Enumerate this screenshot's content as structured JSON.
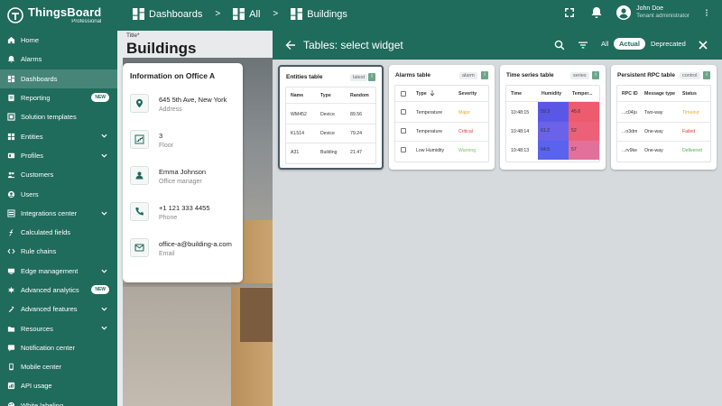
{
  "brand": {
    "name": "ThingsBoard",
    "edition": "Professional"
  },
  "breadcrumb": [
    {
      "label": "Dashboards",
      "icon": "dashboard-icon"
    },
    {
      "label": "All",
      "icon": "dashboard-icon"
    },
    {
      "label": "Buildings",
      "icon": "dashboard-icon"
    }
  ],
  "breadcrumb_sep": ">",
  "user": {
    "name": "John Doe",
    "role": "Tenant administrator"
  },
  "sidebar": {
    "items": [
      {
        "label": "Home",
        "icon": "home-icon"
      },
      {
        "label": "Alarms",
        "icon": "alarm-icon"
      },
      {
        "label": "Dashboards",
        "icon": "dashboard-icon",
        "active": true
      },
      {
        "label": "Reporting",
        "icon": "report-icon",
        "badge": "NEW"
      },
      {
        "label": "Solution templates",
        "icon": "template-icon"
      },
      {
        "label": "Entities",
        "icon": "entities-icon",
        "expandable": true
      },
      {
        "label": "Profiles",
        "icon": "profiles-icon",
        "expandable": true
      },
      {
        "label": "Customers",
        "icon": "customers-icon"
      },
      {
        "label": "Users",
        "icon": "users-icon"
      },
      {
        "label": "Integrations center",
        "icon": "integrations-icon",
        "expandable": true
      },
      {
        "label": "Calculated fields",
        "icon": "function-icon"
      },
      {
        "label": "Rule chains",
        "icon": "rule-chain-icon"
      },
      {
        "label": "Edge management",
        "icon": "edge-icon",
        "expandable": true
      },
      {
        "label": "Advanced analytics",
        "icon": "analytics-icon",
        "badge": "NEW"
      },
      {
        "label": "Advanced features",
        "icon": "features-icon",
        "expandable": true
      },
      {
        "label": "Resources",
        "icon": "resources-icon",
        "expandable": true
      },
      {
        "label": "Notification center",
        "icon": "notification-icon"
      },
      {
        "label": "Mobile center",
        "icon": "mobile-icon"
      },
      {
        "label": "API usage",
        "icon": "api-icon"
      },
      {
        "label": "White labeling",
        "icon": "palette-icon"
      }
    ]
  },
  "dashboard": {
    "title_label": "Title*",
    "title": "Buildings",
    "card": {
      "title": "Information on Office A",
      "rows": [
        {
          "value": "645 5th Ave, New York",
          "label": "Address",
          "icon": "location-icon"
        },
        {
          "value": "3",
          "label": "Floor",
          "icon": "floor-icon"
        },
        {
          "value": "Emma Johnson",
          "label": "Office manager",
          "icon": "person-icon"
        },
        {
          "value": "+1 121 333 4455",
          "label": "Phone",
          "icon": "phone-icon"
        },
        {
          "value": "office-a@building-a.com",
          "label": "Email",
          "icon": "email-icon"
        }
      ]
    }
  },
  "panel": {
    "title": "Tables: select widget",
    "filters": [
      "All",
      "Actual",
      "Deprecated"
    ],
    "selected_filter": "Actual"
  },
  "widgets": [
    {
      "title": "Entities table",
      "tag": "latest",
      "headers": [
        "Name",
        "Type",
        "Random"
      ],
      "rows": [
        [
          "WM452",
          "Device",
          "89.56"
        ],
        [
          "KL514",
          "Device",
          "79.24"
        ],
        [
          "A31",
          "Building",
          "21.47"
        ]
      ]
    },
    {
      "title": "Alarms table",
      "tag": "alarm",
      "headers": [
        "Type",
        "Severity"
      ],
      "rows": [
        {
          "type": "Temperature",
          "severity": "Major",
          "color": "#f5a623"
        },
        {
          "type": "Temperature",
          "severity": "Critical",
          "color": "#e53935"
        },
        {
          "type": "Low Humidity",
          "severity": "Warning",
          "color": "#7fb96b"
        }
      ]
    },
    {
      "title": "Time series table",
      "tag": "series",
      "headers": [
        "Time",
        "Humidity",
        "Temper..."
      ],
      "rows": [
        {
          "time": "10:48:15",
          "humidity": "59.3",
          "temp": "45.6",
          "hcolor": "#5b57e6",
          "tcolor": "#ee5a6e"
        },
        {
          "time": "10:48:14",
          "humidity": "61.2",
          "temp": "52",
          "hcolor": "#6b62ea",
          "tcolor": "#ec6178"
        },
        {
          "time": "10:48:13",
          "humidity": "64.5",
          "temp": "57",
          "hcolor": "#5a63ee",
          "tcolor": "#e3709a"
        }
      ]
    },
    {
      "title": "Persistent RPC table",
      "tag": "control",
      "headers": [
        "RPC ID",
        "Message type",
        "Status"
      ],
      "rows": [
        {
          "id": "...c04ju",
          "type": "Two-way",
          "status": "Timeout",
          "color": "#f5a623"
        },
        {
          "id": "...o3dm",
          "type": "One-way",
          "status": "Failed",
          "color": "#e53935"
        },
        {
          "id": "...rv9ke",
          "type": "One-way",
          "status": "Delivered",
          "color": "#4caf50"
        }
      ]
    }
  ]
}
